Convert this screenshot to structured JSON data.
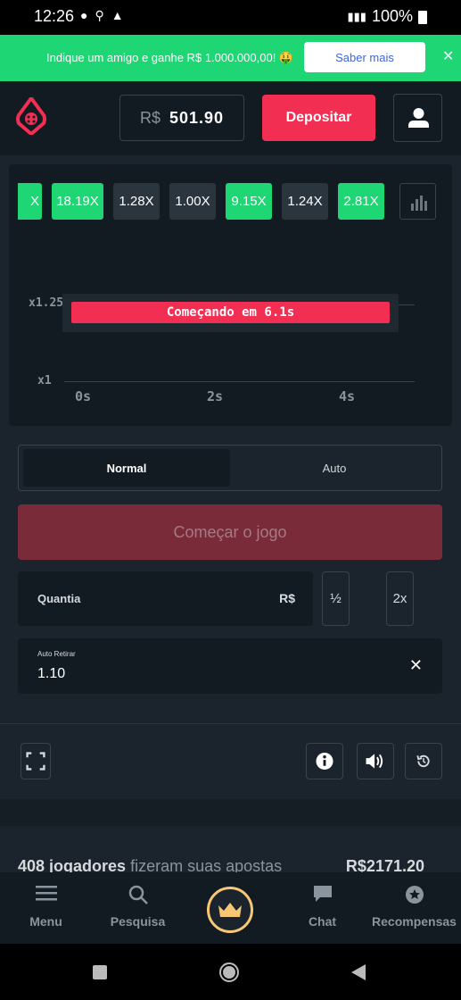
{
  "status_bar": {
    "time": "12:26",
    "battery": "100%"
  },
  "promo": {
    "text": "Indique um amigo e ganhe R$ 1.000.000,00! 🤑",
    "button": "Saber mais",
    "close": "✕"
  },
  "header": {
    "currency": "R$",
    "balance": "501.90",
    "deposit": "Depositar"
  },
  "history": [
    "X",
    "18.19X",
    "1.28X",
    "1.00X",
    "9.15X",
    "1.24X",
    "2.81X"
  ],
  "game": {
    "y_labels": [
      "x1.25",
      "x1"
    ],
    "x_labels": [
      "0s",
      "2s",
      "4s"
    ],
    "countdown": "Começando em 6.1s"
  },
  "tabs": {
    "normal": "Normal",
    "auto": "Auto"
  },
  "start_button": "Começar o jogo",
  "quantity": {
    "label": "Quantia",
    "currency": "R$",
    "half": "½",
    "double": "2x"
  },
  "auto_cashout": {
    "label": "Auto Retirar",
    "value": "1.10",
    "clear": "✕"
  },
  "players": {
    "count_text": "408 jogadores",
    "suffix": " fizeram suas apostas",
    "amount": "R$2171.20"
  },
  "nav": {
    "menu": "Menu",
    "search": "Pesquisa",
    "chat": "Chat",
    "rewards": "Recompensas"
  },
  "colors": {
    "green": "#1ed673",
    "red": "#f22e52",
    "dark": "#131b22",
    "bg": "#1b242c"
  }
}
